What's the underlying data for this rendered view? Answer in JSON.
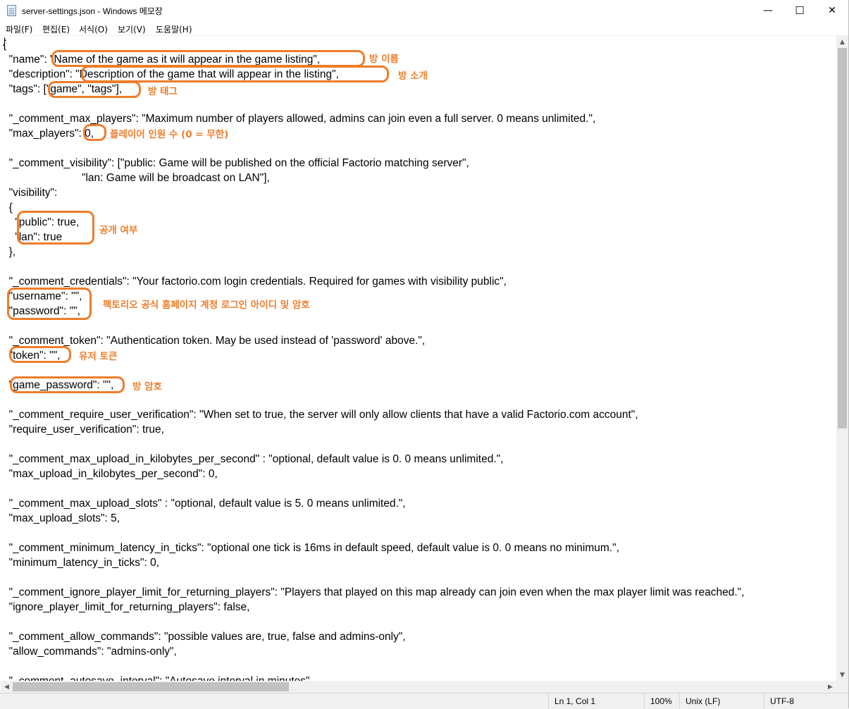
{
  "window": {
    "title": "server-settings.json - Windows 메모장",
    "minimize_glyph": "—",
    "maximize_glyph": "☐",
    "close_glyph": "✕",
    "icon": "notepad-icon"
  },
  "menu": [
    "파일(F)",
    "편집(E)",
    "서식(O)",
    "보기(V)",
    "도움말(H)"
  ],
  "lines": [
    "{",
    "  \"name\": \"Name of the game as it will appear in the game listing\",",
    "  \"description\": \"Description of the game that will appear in the listing\",",
    "  \"tags\": [\"game\", \"tags\"],",
    "",
    "  \"_comment_max_players\": \"Maximum number of players allowed, admins can join even a full server. 0 means unlimited.\",",
    "  \"max_players\": 0,",
    "",
    "  \"_comment_visibility\": [\"public: Game will be published on the official Factorio matching server\",",
    "                          \"lan: Game will be broadcast on LAN\"],",
    "  \"visibility\":",
    "  {",
    "    \"public\": true,",
    "    \"lan\": true",
    "  },",
    "",
    "  \"_comment_credentials\": \"Your factorio.com login credentials. Required for games with visibility public\",",
    "  \"username\": \"\",",
    "  \"password\": \"\",",
    "",
    "  \"_comment_token\": \"Authentication token. May be used instead of 'password' above.\",",
    "  \"token\": \"\",",
    "",
    "  \"game_password\": \"\",",
    "",
    "  \"_comment_require_user_verification\": \"When set to true, the server will only allow clients that have a valid Factorio.com account\",",
    "  \"require_user_verification\": true,",
    "",
    "  \"_comment_max_upload_in_kilobytes_per_second\" : \"optional, default value is 0. 0 means unlimited.\",",
    "  \"max_upload_in_kilobytes_per_second\": 0,",
    "",
    "  \"_comment_max_upload_slots\" : \"optional, default value is 5. 0 means unlimited.\",",
    "  \"max_upload_slots\": 5,",
    "",
    "  \"_comment_minimum_latency_in_ticks\": \"optional one tick is 16ms in default speed, default value is 0. 0 means no minimum.\",",
    "  \"minimum_latency_in_ticks\": 0,",
    "",
    "  \"_comment_ignore_player_limit_for_returning_players\": \"Players that played on this map already can join even when the max player limit was reached.\",",
    "  \"ignore_player_limit_for_returning_players\": false,",
    "",
    "  \"_comment_allow_commands\": \"possible values are, true, false and admins-only\",",
    "  \"allow_commands\": \"admins-only\",",
    "",
    "  \"_comment_autosave_interval\": \"Autosave interval in minutes\","
  ],
  "annotations": {
    "name": "방 이름",
    "description": "방 소개",
    "tags": "방 태그",
    "max_players": "플레이어 인원 수 (0 = 무한)",
    "visibility": "공개 여부",
    "credentials": "팩토리오 공식 홈페이지 계정 로그인 아이디 및 암호",
    "token": "유저 토큰",
    "game_password": "방 암호"
  },
  "status": {
    "position": "Ln 1, Col 1",
    "zoom": "100%",
    "line_ending": "Unix (LF)",
    "encoding": "UTF-8"
  }
}
